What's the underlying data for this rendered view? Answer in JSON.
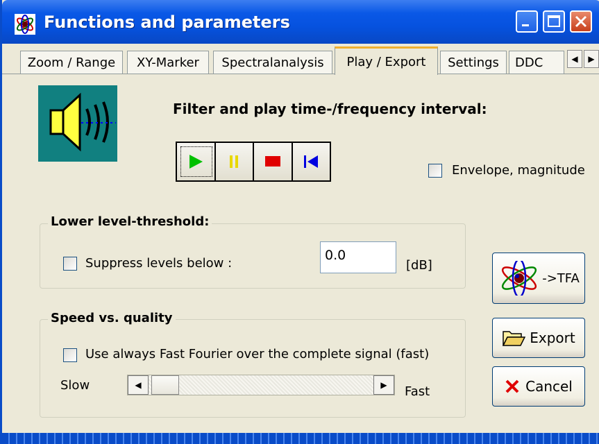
{
  "window": {
    "title": "Functions and parameters"
  },
  "tabs": [
    {
      "label": "Zoom / Range"
    },
    {
      "label": "XY-Marker"
    },
    {
      "label": "Spectralanalysis"
    },
    {
      "label": "Play / Export",
      "selected": true
    },
    {
      "label": "Settings"
    },
    {
      "label": "DDC"
    }
  ],
  "play": {
    "heading": "Filter and play time-/frequency interval:",
    "buttons": [
      "play-icon",
      "pause-icon",
      "stop-icon",
      "rewind-icon"
    ],
    "envelope_label": "Envelope, magnitude",
    "envelope_checked": false
  },
  "threshold": {
    "group_label": "Lower level-threshold:",
    "suppress_label": "Suppress levels below :",
    "suppress_checked": false,
    "value": "0.0",
    "unit": "[dB]"
  },
  "speed": {
    "group_label": "Speed vs. quality",
    "fft_label": "Use always Fast Fourier over the complete signal (fast)",
    "fft_checked": false,
    "slow_label": "Slow",
    "fast_label": "Fast",
    "slider_position": 0.0
  },
  "buttons": {
    "tfa_label": "->TFA",
    "export_label": "Export",
    "cancel_label": "Cancel"
  },
  "colors": {
    "titlebar": "#0a58e6",
    "tab_accent": "#f0b030",
    "dialog_bg": "#ece9d8"
  }
}
